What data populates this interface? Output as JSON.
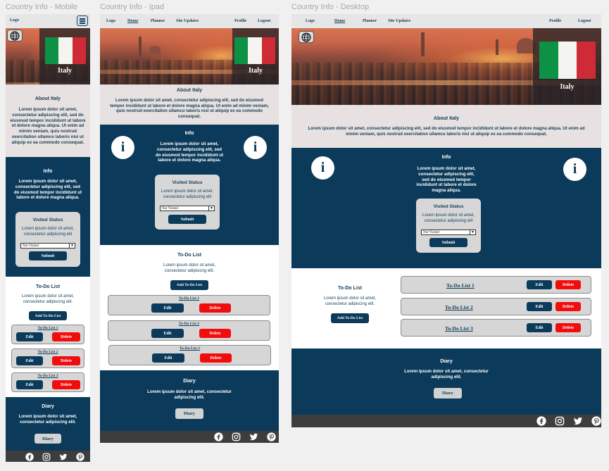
{
  "frames": {
    "mobile": "Country Info - Mobile",
    "ipad": "Country Info - Ipad",
    "desktop": "Country Info - Desktop"
  },
  "nav": {
    "logo": "Logo",
    "home": "Home",
    "planner": "Planner",
    "site_updates": "Site Updates",
    "profile": "Profile",
    "logout": "Logout"
  },
  "country": "Italy",
  "about": {
    "title": "About Italy",
    "mobile_text": "Lorem ipsum dolor sit amet, consectetur adipiscing elit, sed do eiusmod tempor incididunt ut labore et dolore magna aliqua. Ut enim ad minim veniam, quis nostrud exercitation ullamco laboris nisi ut aliquip ex ea commodo consequat.",
    "ipad_text": "Lorem ipsum dolor sit amet, consectetur adipiscing elit, sed do eiusmod tempor incididunt ut labore et dolore magna aliqua. Ut enim ad minim veniam, quis nostrud exercitation ullamco laboris nisi ut aliquip ex ea commodo consequat.",
    "desktop_text": "Lorem ipsum dolor sit amet, consectetur adipiscing elit, sed do eiusmod tempor incididunt ut labore et dolore magna aliqua. Ut enim ad minim veniam, quis nostrud exercitation ullamco laboris nisi ut aliquip ex ea commodo consequat."
  },
  "info": {
    "title": "Info",
    "text": "Lorem ipsum dolor sit amet, consectetur adipiscing elit, sed do eiusmod tempor incididunt ut labore et dolore magna aliqua.",
    "icon_letter": "i"
  },
  "visited": {
    "title": "Visited Status",
    "text": "Lorem ipsum dolor sit amet, consectetur adipiscing elit",
    "select_value": "Not Visited",
    "submit": "Submit"
  },
  "todo": {
    "title": "To-Do List",
    "text": "Lorem ipsum dolor sit amet, consectetur adipiscing elit.",
    "add": "Add To-Do List",
    "items": [
      "To-Do List 1",
      "To-Do List 2",
      "To-Do List 3"
    ],
    "edit": "Edit",
    "delete": "Delete"
  },
  "diary": {
    "title": "Diary",
    "text": "Lorem ipsum dolor sit amet, consectetur adipiscing elit.",
    "button": "Diary"
  },
  "social": [
    "facebook-icon",
    "instagram-icon",
    "twitter-icon",
    "pinterest-icon"
  ],
  "colors": {
    "navy": "#0b3a5a",
    "red": "#f10d0d",
    "about_bg": "#e8e1e1",
    "flag_green": "#0d9245",
    "flag_red": "#ce2b37"
  }
}
